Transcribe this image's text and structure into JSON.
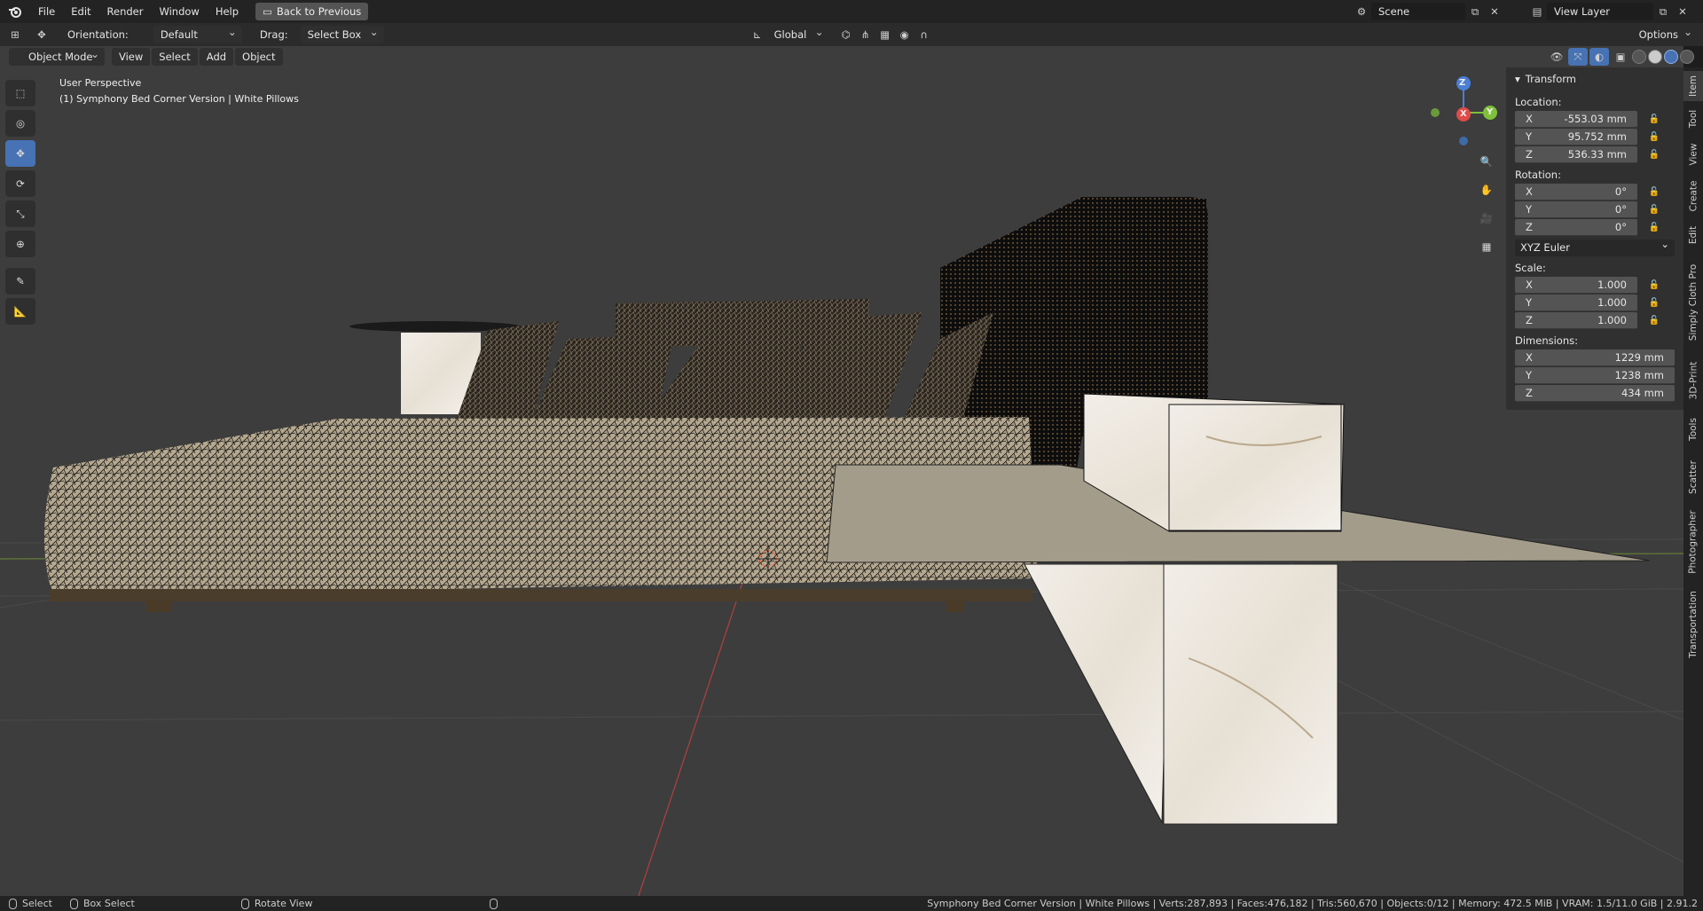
{
  "menu": {
    "items": [
      "File",
      "Edit",
      "Render",
      "Window",
      "Help"
    ],
    "back_button": "Back to Previous",
    "scene": "Scene",
    "view_layer": "View Layer"
  },
  "tool_settings": {
    "orientation_label": "Orientation:",
    "orientation_value": "Default",
    "drag_label": "Drag:",
    "drag_value": "Select Box",
    "transform_orientation": "Global",
    "options": "Options"
  },
  "viewport_header": {
    "mode": "Object Mode",
    "menus": [
      "View",
      "Select",
      "Add",
      "Object"
    ]
  },
  "viewport": {
    "perspective": "User Perspective",
    "active_object": "(1) Symphony Bed Corner Version | White Pillows",
    "gizmo_axes": [
      "X",
      "Y",
      "Z"
    ]
  },
  "npanel": {
    "title": "Transform",
    "location_label": "Location:",
    "location": [
      {
        "axis": "X",
        "value": "-553.03 mm"
      },
      {
        "axis": "Y",
        "value": "95.752 mm"
      },
      {
        "axis": "Z",
        "value": "536.33 mm"
      }
    ],
    "rotation_label": "Rotation:",
    "rotation": [
      {
        "axis": "X",
        "value": "0°"
      },
      {
        "axis": "Y",
        "value": "0°"
      },
      {
        "axis": "Z",
        "value": "0°"
      }
    ],
    "rotation_mode": "XYZ Euler",
    "scale_label": "Scale:",
    "scale": [
      {
        "axis": "X",
        "value": "1.000"
      },
      {
        "axis": "Y",
        "value": "1.000"
      },
      {
        "axis": "Z",
        "value": "1.000"
      }
    ],
    "dimensions_label": "Dimensions:",
    "dimensions": [
      {
        "axis": "X",
        "value": "1229 mm"
      },
      {
        "axis": "Y",
        "value": "1238 mm"
      },
      {
        "axis": "Z",
        "value": "434 mm"
      }
    ]
  },
  "side_tabs": [
    "Item",
    "Tool",
    "View",
    "Create",
    "Edit",
    "Simply Cloth Pro",
    "3D-Print",
    "Tools",
    "Scatter",
    "Photographer",
    "Transportation"
  ],
  "statusbar": {
    "select": "Select",
    "box_select": "Box Select",
    "rotate_view": "Rotate View",
    "info": "Symphony Bed Corner Version | White Pillows | Verts:287,893 | Faces:476,182 | Tris:560,670 | Objects:0/12 | Memory: 472.5 MiB | VRAM: 1.5/11.0 GiB | 2.91.2"
  }
}
